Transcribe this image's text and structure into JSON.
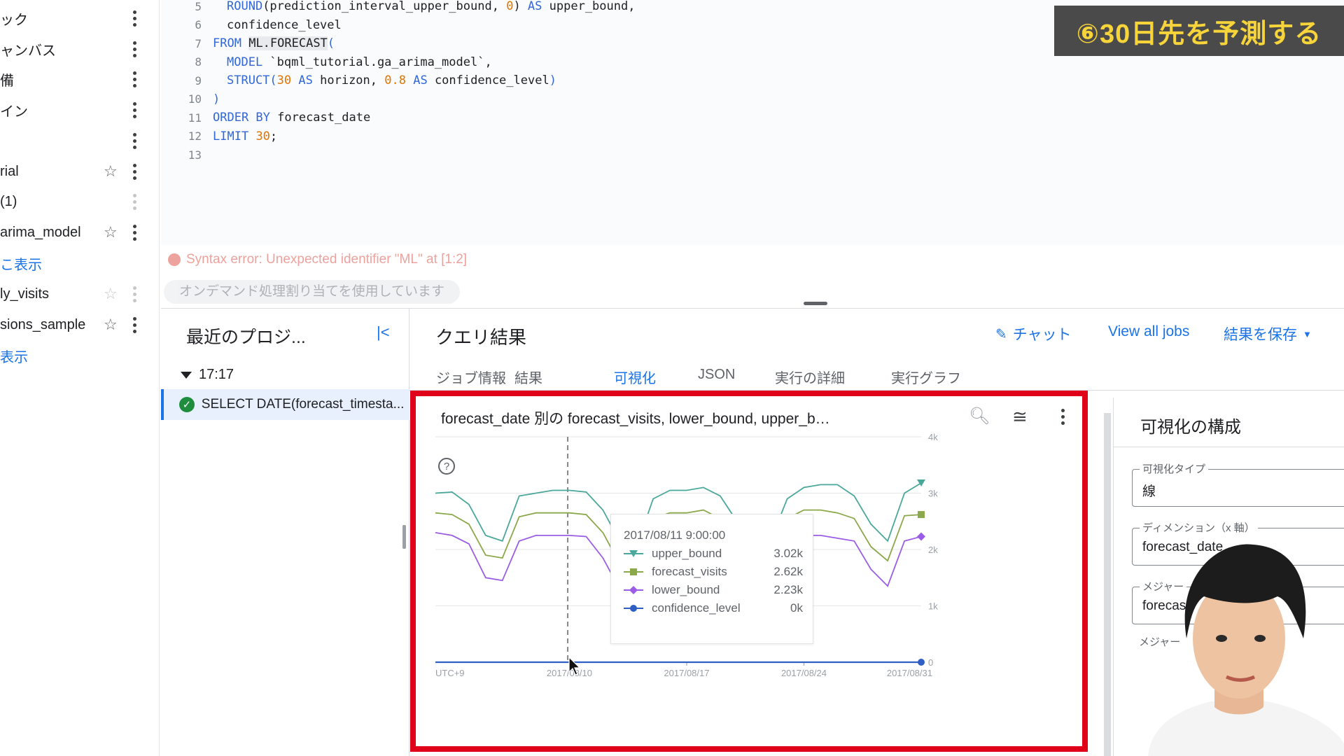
{
  "overlay": {
    "title": "⑥30日先を予測する"
  },
  "explorer": {
    "items": [
      {
        "label": "ック",
        "starred": false,
        "star": false,
        "link": false
      },
      {
        "label": "ャンバス",
        "star": false,
        "link": false
      },
      {
        "label": "備",
        "star": false,
        "link": false
      },
      {
        "label": "イン",
        "star": false,
        "link": false
      },
      {
        "label": "",
        "star": false,
        "link": false
      },
      {
        "label": "rial",
        "star": true,
        "star_filled": false,
        "link": false
      },
      {
        "label": "(1)",
        "star": false,
        "link": false,
        "faint": true
      },
      {
        "label": "arima_model",
        "star": true,
        "link": false
      },
      {
        "label": "こ表示",
        "star": false,
        "link": true,
        "no_menu": true
      },
      {
        "label": "ly_visits",
        "star": true,
        "link": false,
        "faint": true
      },
      {
        "label": "sions_sample",
        "star": true,
        "link": false
      },
      {
        "label": "表示",
        "star": false,
        "link": true,
        "no_menu": true
      }
    ]
  },
  "editor": {
    "lines": [
      {
        "n": "5",
        "parts": [
          [
            "fn",
            "ROUND"
          ],
          [
            "t",
            "(prediction_interval_upper_bound, "
          ],
          [
            "num",
            "0"
          ],
          [
            "t",
            ") "
          ],
          [
            "kw",
            "AS"
          ],
          [
            "t",
            " upper_bound,"
          ]
        ],
        "indent": 1
      },
      {
        "n": "6",
        "parts": [
          [
            "t",
            "confidence_level"
          ]
        ],
        "indent": 1
      },
      {
        "n": "7",
        "parts": [
          [
            "kw",
            "FROM"
          ],
          [
            "t",
            " "
          ],
          [
            "hl",
            "ML.FORECAST"
          ],
          [
            "kw",
            "("
          ]
        ],
        "indent": 0
      },
      {
        "n": "8",
        "parts": [
          [
            "kw",
            "MODEL"
          ],
          [
            "t",
            " `bqml_tutorial.ga_arima_model`,"
          ]
        ],
        "indent": 1
      },
      {
        "n": "9",
        "parts": [
          [
            "kw",
            "STRUCT"
          ],
          [
            "kw",
            "("
          ],
          [
            "num",
            "30"
          ],
          [
            "t",
            " "
          ],
          [
            "kw",
            "AS"
          ],
          [
            "t",
            " horizon, "
          ],
          [
            "num",
            "0.8"
          ],
          [
            "t",
            " "
          ],
          [
            "kw",
            "AS"
          ],
          [
            "t",
            " confidence_level"
          ],
          [
            "kw",
            ")"
          ]
        ],
        "indent": 1
      },
      {
        "n": "10",
        "parts": [
          [
            "kw",
            ")"
          ]
        ],
        "indent": 0
      },
      {
        "n": "11",
        "parts": [
          [
            "kw",
            "ORDER BY"
          ],
          [
            "t",
            " forecast_date"
          ]
        ],
        "indent": 0
      },
      {
        "n": "12",
        "parts": [
          [
            "kw",
            "LIMIT"
          ],
          [
            "t",
            " "
          ],
          [
            "num",
            "30"
          ],
          [
            "t",
            ";"
          ]
        ],
        "indent": 0
      },
      {
        "n": "13",
        "parts": [],
        "indent": 0
      }
    ],
    "error": "Syntax error: Unexpected identifier \"ML\" at [1:2]",
    "allocation": "オンデマンド処理割り当てを使用しています"
  },
  "recent": {
    "title": "最近のプロジ...",
    "collapse_icon": "|<",
    "time": "17:17",
    "job": "SELECT DATE(forecast_timesta..."
  },
  "results": {
    "title": "クエリ結果",
    "chat_label": "チャット",
    "view_all_jobs": "View all jobs",
    "save_results": "結果を保存",
    "tabs": [
      "ジョブ情報",
      "結果",
      "可視化",
      "JSON",
      "実行の詳細",
      "実行グラフ"
    ],
    "active_tab": 2
  },
  "chart": {
    "title": "forecast_date 別の forecast_visits, lower_bound, upper_bound, confid...",
    "tooltip": {
      "date": "2017/08/11 9:00:00",
      "rows": [
        {
          "name": "upper_bound",
          "value": "3.02k",
          "color": "#4aa89a",
          "marker": "triangle"
        },
        {
          "name": "forecast_visits",
          "value": "2.62k",
          "color": "#8ba84a",
          "marker": "square"
        },
        {
          "name": "lower_bound",
          "value": "2.23k",
          "color": "#9b5de5",
          "marker": "diamond"
        },
        {
          "name": "confidence_level",
          "value": "0k",
          "color": "#2f5fc4",
          "marker": "circle"
        }
      ]
    }
  },
  "chart_data": {
    "type": "line",
    "x": [
      "2017/08/02",
      "2017/08/03",
      "2017/08/04",
      "2017/08/05",
      "2017/08/06",
      "2017/08/07",
      "2017/08/08",
      "2017/08/09",
      "2017/08/10",
      "2017/08/11",
      "2017/08/12",
      "2017/08/13",
      "2017/08/14",
      "2017/08/15",
      "2017/08/16",
      "2017/08/17",
      "2017/08/18",
      "2017/08/19",
      "2017/08/20",
      "2017/08/21",
      "2017/08/22",
      "2017/08/23",
      "2017/08/24",
      "2017/08/25",
      "2017/08/26",
      "2017/08/27",
      "2017/08/28",
      "2017/08/29",
      "2017/08/30",
      "2017/08/31"
    ],
    "series": [
      {
        "name": "upper_bound",
        "color": "#4aa89a",
        "values": [
          3000,
          3020,
          2800,
          2250,
          2150,
          2950,
          3000,
          3050,
          3050,
          3020,
          2700,
          2150,
          2050,
          2900,
          3050,
          3050,
          3100,
          2950,
          2500,
          2150,
          2150,
          2900,
          3100,
          3150,
          3150,
          2950,
          2450,
          2150,
          3000,
          3180
        ]
      },
      {
        "name": "forecast_visits",
        "color": "#8ba84a",
        "values": [
          2650,
          2620,
          2450,
          1900,
          1850,
          2580,
          2650,
          2650,
          2650,
          2620,
          2300,
          1750,
          1750,
          2550,
          2650,
          2650,
          2700,
          2550,
          2100,
          1800,
          1800,
          2550,
          2700,
          2700,
          2650,
          2550,
          2050,
          1800,
          2600,
          2620
        ]
      },
      {
        "name": "lower_bound",
        "color": "#9b5de5",
        "values": [
          2300,
          2250,
          2100,
          1500,
          1450,
          2150,
          2250,
          2250,
          2250,
          2230,
          1850,
          1300,
          1350,
          2100,
          2250,
          2250,
          2300,
          2100,
          1650,
          1350,
          1350,
          2050,
          2250,
          2250,
          2200,
          2150,
          1650,
          1350,
          2150,
          2230
        ]
      },
      {
        "name": "confidence_level",
        "color": "#2f5fc4",
        "values": [
          0,
          0,
          0,
          0,
          0,
          0,
          0,
          0,
          0,
          0,
          0,
          0,
          0,
          0,
          0,
          0,
          0,
          0,
          0,
          0,
          0,
          0,
          0,
          0,
          0,
          0,
          0,
          0,
          0,
          0
        ]
      }
    ],
    "ylim": [
      0,
      4000
    ],
    "yticks": [
      {
        "value": 0,
        "label": "0"
      },
      {
        "value": 1000,
        "label": "1k"
      },
      {
        "value": 2000,
        "label": "2k"
      },
      {
        "value": 3000,
        "label": "3k"
      },
      {
        "value": 4000,
        "label": "4k"
      }
    ],
    "xticks": [
      {
        "index": 0,
        "label": "UTC+9"
      },
      {
        "index": 8,
        "label": "2017/08/10"
      },
      {
        "index": 15,
        "label": "2017/08/17"
      },
      {
        "index": 22,
        "label": "2017/08/24"
      },
      {
        "index": 29,
        "label": "2017/08/31"
      }
    ],
    "hover_index": 9,
    "grid": true
  },
  "config": {
    "title": "可視化の構成",
    "fields": [
      {
        "label": "可視化タイプ",
        "value": "線"
      },
      {
        "label": "ディメンション（x 軸）",
        "value": "forecast_date"
      },
      {
        "label": "メジャー",
        "value": "forecas"
      }
    ],
    "extra_label": "メジャー"
  }
}
